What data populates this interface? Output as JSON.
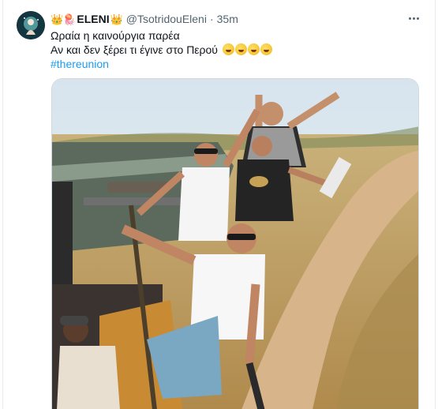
{
  "tweet": {
    "display_name": "ELENI",
    "handle": "@TsotridouEleni",
    "separator": "·",
    "time": "35m",
    "text_line1": "Ωραία η καινούργια παρέα",
    "text_line2": "Αν και δεν ξέρει τι έγινε στο Περού",
    "hashtag": "#thereunion",
    "name_emoji_left": "👑🪼",
    "name_emoji_right": "👑",
    "reaction_emoji": "rolling-on-floor-laughing",
    "reaction_emoji_count": 4
  },
  "icons": {
    "avatar": "profile-avatar",
    "more": "more-options-icon",
    "reaction": "laughing-emoji-icon"
  },
  "media": {
    "description_icon": "safari-selfie-photo"
  },
  "colors": {
    "link": "#1d9bf0",
    "text": "#0f1419",
    "secondary": "#536471"
  }
}
